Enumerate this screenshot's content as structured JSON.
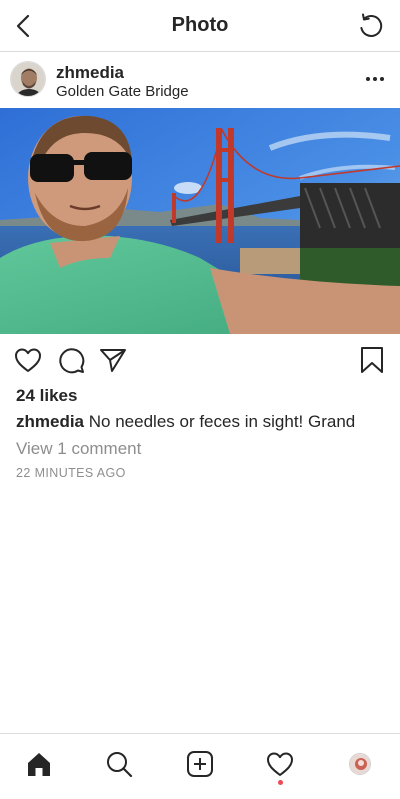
{
  "header": {
    "title": "Photo",
    "back_icon": "chevron-left-icon",
    "refresh_icon": "refresh-icon"
  },
  "post": {
    "username": "zhmedia",
    "location": "Golden Gate Bridge",
    "likes": "24 likes",
    "caption_user": "zhmedia",
    "caption_text": "No needles or feces in sight! Grand",
    "view_comments": "View 1 comment",
    "timestamp": "22 MINUTES AGO"
  },
  "actions": {
    "like_icon": "heart-icon",
    "comment_icon": "comment-icon",
    "share_icon": "send-icon",
    "save_icon": "bookmark-icon"
  },
  "tabbar": {
    "items": [
      "home-icon",
      "search-icon",
      "new-post-icon",
      "activity-icon",
      "profile-avatar"
    ],
    "notification_color": "#ed4956"
  },
  "colors": {
    "text": "#262626",
    "muted": "#8e8e8e",
    "divider": "#dbdbdb"
  }
}
